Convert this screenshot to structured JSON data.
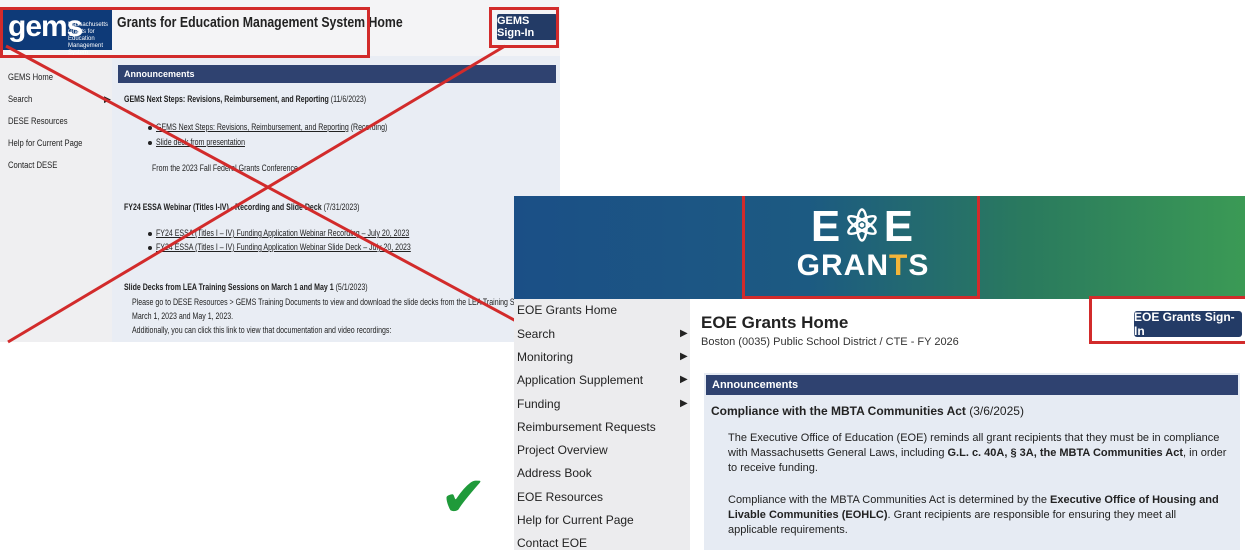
{
  "old_page": {
    "logo_text": "gems",
    "logo_subtext": "Massachusetts Grants for Education Management System",
    "title": "Grants for Education Management System Home",
    "signin_label": "GEMS Sign-In",
    "sidebar": [
      {
        "label": "GEMS Home"
      },
      {
        "label": "Search",
        "arrow": "▶"
      },
      {
        "label": "DESE Resources"
      },
      {
        "label": "Help for Current Page"
      },
      {
        "label": "Contact DESE"
      }
    ],
    "announcements_label": "Announcements",
    "items": {
      "a1_title": "GEMS Next Steps: Revisions, Reimbursement, and Reporting",
      "a1_date": "(11/6/2023)",
      "a1_link1": "GEMS Next Steps: Revisions, Reimbursement, and Reporting",
      "a1_link1_suffix": "(Recording)",
      "a1_link2": "Slide deck from presentation",
      "a1_note": "From the 2023 Fall Federal Grants Conference",
      "a2_title": "FY24 ESSA Webinar (Titles I-IV) - Recording and Slide Deck",
      "a2_date": "(7/31/2023)",
      "a2_link1": "FY24 ESSA (Titles I – IV) Funding Application Webinar Recording – July 20, 2023",
      "a2_link2": "FY24 ESSA (Titles I – IV) Funding Application Webinar Slide Deck – July 20, 2023",
      "a3_title": "Slide Decks from LEA Training Sessions on March 1 and May 1",
      "a3_date": "(5/1/2023)",
      "a3_line1": "Please go to DESE Resources > GEMS Training Documents to view and download the slide decks from the LEA Training Sessions",
      "a3_line2": "March 1, 2023 and May 1, 2023.",
      "a3_line3": "Additionally, you can click this link to view that documentation and video recordings:"
    }
  },
  "new_page": {
    "brand_top": "E⚛E",
    "brand_bottom_a": "GRAN",
    "brand_bottom_t": "T",
    "brand_bottom_b": "S",
    "title": "EOE Grants Home",
    "subtitle": "Boston (0035) Public School District / CTE - FY 2026",
    "signin_label": "EOE Grants Sign-In",
    "sidebar": [
      {
        "label": "EOE Grants Home",
        "arrow": ""
      },
      {
        "label": "Search",
        "arrow": "▶"
      },
      {
        "label": "Monitoring",
        "arrow": "▶"
      },
      {
        "label": "Application Supplement",
        "arrow": "▶"
      },
      {
        "label": "Funding",
        "arrow": "▶"
      },
      {
        "label": "Reimbursement Requests",
        "arrow": ""
      },
      {
        "label": "Project Overview",
        "arrow": ""
      },
      {
        "label": "Address Book",
        "arrow": ""
      },
      {
        "label": "EOE Resources",
        "arrow": ""
      },
      {
        "label": "Help for Current Page",
        "arrow": ""
      },
      {
        "label": "Contact EOE",
        "arrow": ""
      }
    ],
    "announcements_label": "Announcements",
    "notice_title": "Compliance with the MBTA Communities Act",
    "notice_date": "(3/6/2025)",
    "p1_a": "The Executive Office of Education (EOE) reminds all grant recipients that they must be in compliance with Massachusetts General Laws, including ",
    "p1_b": "G.L. c. 40A, § 3A, the MBTA Communities Act",
    "p1_c": ", in order to receive funding.",
    "p2_a": "Compliance with the MBTA Communities Act is determined by the ",
    "p2_b": "Executive Office of Housing and Livable Communities (EOHLC)",
    "p2_c": ". Grant recipients are responsible for ensuring they meet all applicable requirements."
  },
  "annotations": {
    "checkmark": "✔",
    "accent_red": "#d22b2b",
    "check_green": "#1f9a3a"
  }
}
